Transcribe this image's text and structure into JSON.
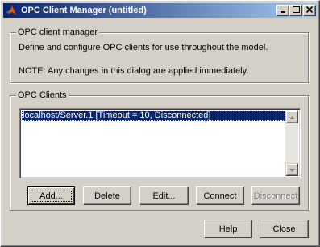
{
  "window": {
    "title": "OPC Client Manager (untitled)",
    "app_icon": "matlab-icon",
    "controls": [
      "minimize-icon",
      "maximize-icon",
      "close-icon"
    ]
  },
  "info_group": {
    "legend": "OPC client manager",
    "description": "Define and configure OPC clients for use throughout the model.",
    "note": "NOTE: Any changes in this dialog are applied immediately."
  },
  "clients_group": {
    "legend": "OPC Clients",
    "items": [
      {
        "label": "localhost/Server.1 [Timeout = 10, Disconnected]",
        "selected": true
      }
    ],
    "buttons": {
      "add": "Add...",
      "delete": "Delete",
      "edit": "Edit...",
      "connect": "Connect",
      "disconnect": "Disconnect"
    }
  },
  "footer": {
    "help": "Help",
    "close": "Close"
  },
  "colors": {
    "title_start": "#0a246a",
    "title_end": "#a6caf0",
    "face": "#d4d0c8",
    "selection": "#0a246a"
  }
}
